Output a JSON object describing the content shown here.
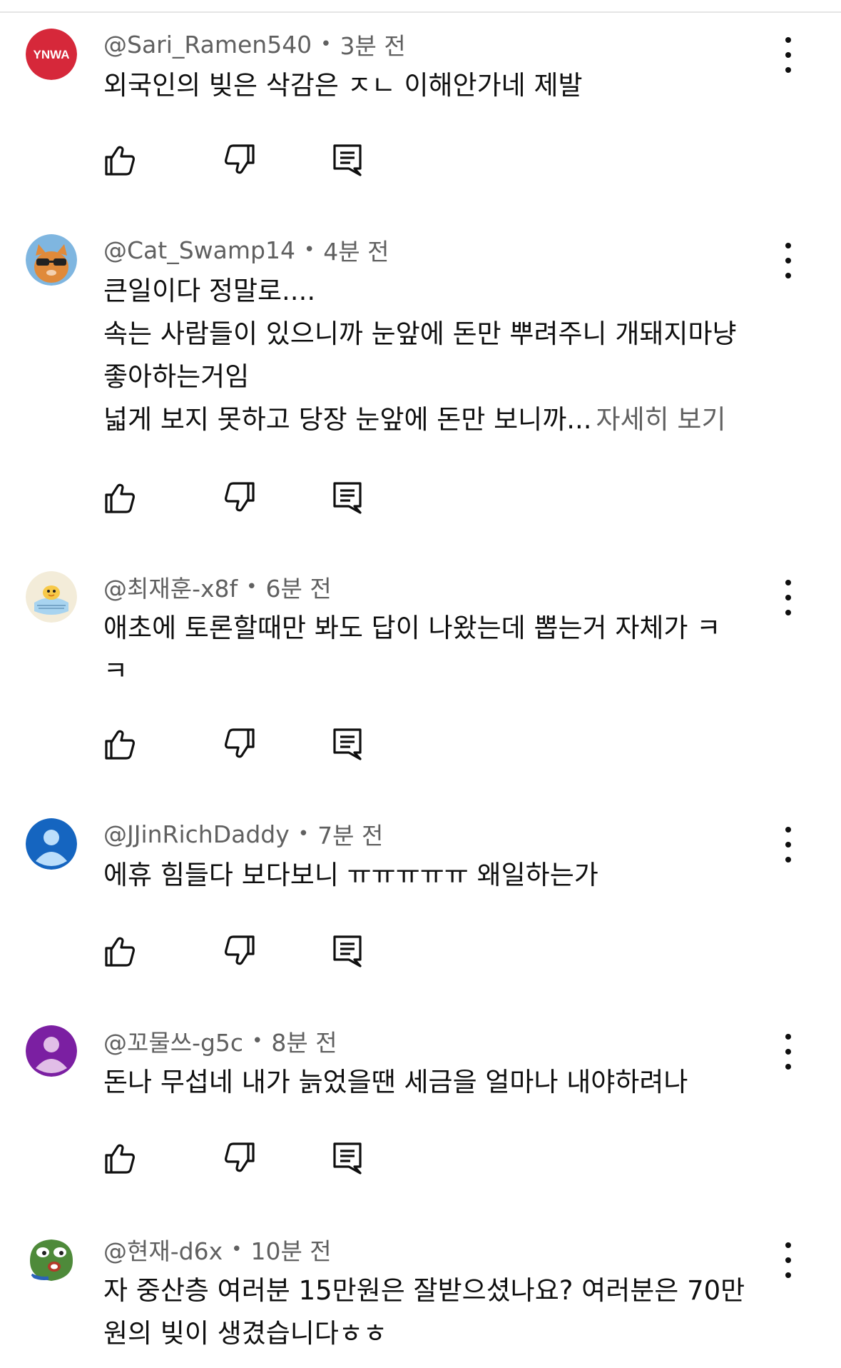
{
  "comments": [
    {
      "handle": "@Sari_Ramen540",
      "time": "3분 전",
      "avatar_text": "YNWA",
      "lines": [
        "외국인의 빚은 삭감은 ㅈㄴ 이해안가네 제발"
      ]
    },
    {
      "handle": "@Cat_Swamp14",
      "time": "4분 전",
      "lines": [
        "큰일이다 정말로....",
        "속는 사람들이 있으니까 눈앞에 돈만 뿌려주니 개돼지마냥",
        "좋아하는거임",
        "넓게 보지 못하고 당장 눈앞에 돈만 보니까..."
      ],
      "more": "자세히 보기"
    },
    {
      "handle": "@최재훈-x8f",
      "time": "6분 전",
      "lines": [
        "애초에 토론할때만 봐도 답이 나왔는데 뽑는거 자체가 ㅋ",
        "ㅋ"
      ]
    },
    {
      "handle": "@JJinRichDaddy",
      "time": "7분 전",
      "lines": [
        "에휴 힘들다 보다보니 ㅠㅠㅠㅠㅠ 왜일하는가"
      ]
    },
    {
      "handle": "@꼬물쓰-g5c",
      "time": "8분 전",
      "lines": [
        "돈나 무섭네 내가 늙었을땐 세금을 얼마나 내야하려나"
      ]
    },
    {
      "handle": "@현재-d6x",
      "time": "10분 전",
      "lines": [
        "자 중산층 여러분 15만원은 잘받으셨나요? 여러분은 70만",
        "원의 빚이 생겼습니다ㅎㅎ"
      ]
    }
  ],
  "colors": {
    "ynwa_red": "#d6283a",
    "default_avatar_blue": "#1565c0",
    "default_avatar_purple": "#7b1fa2",
    "meta_gray": "#606060",
    "text": "#0f0f0f"
  },
  "icons": {
    "like": "thumbs-up-icon",
    "dislike": "thumbs-down-icon",
    "reply": "reply-comment-icon",
    "menu": "more-vert-icon"
  }
}
